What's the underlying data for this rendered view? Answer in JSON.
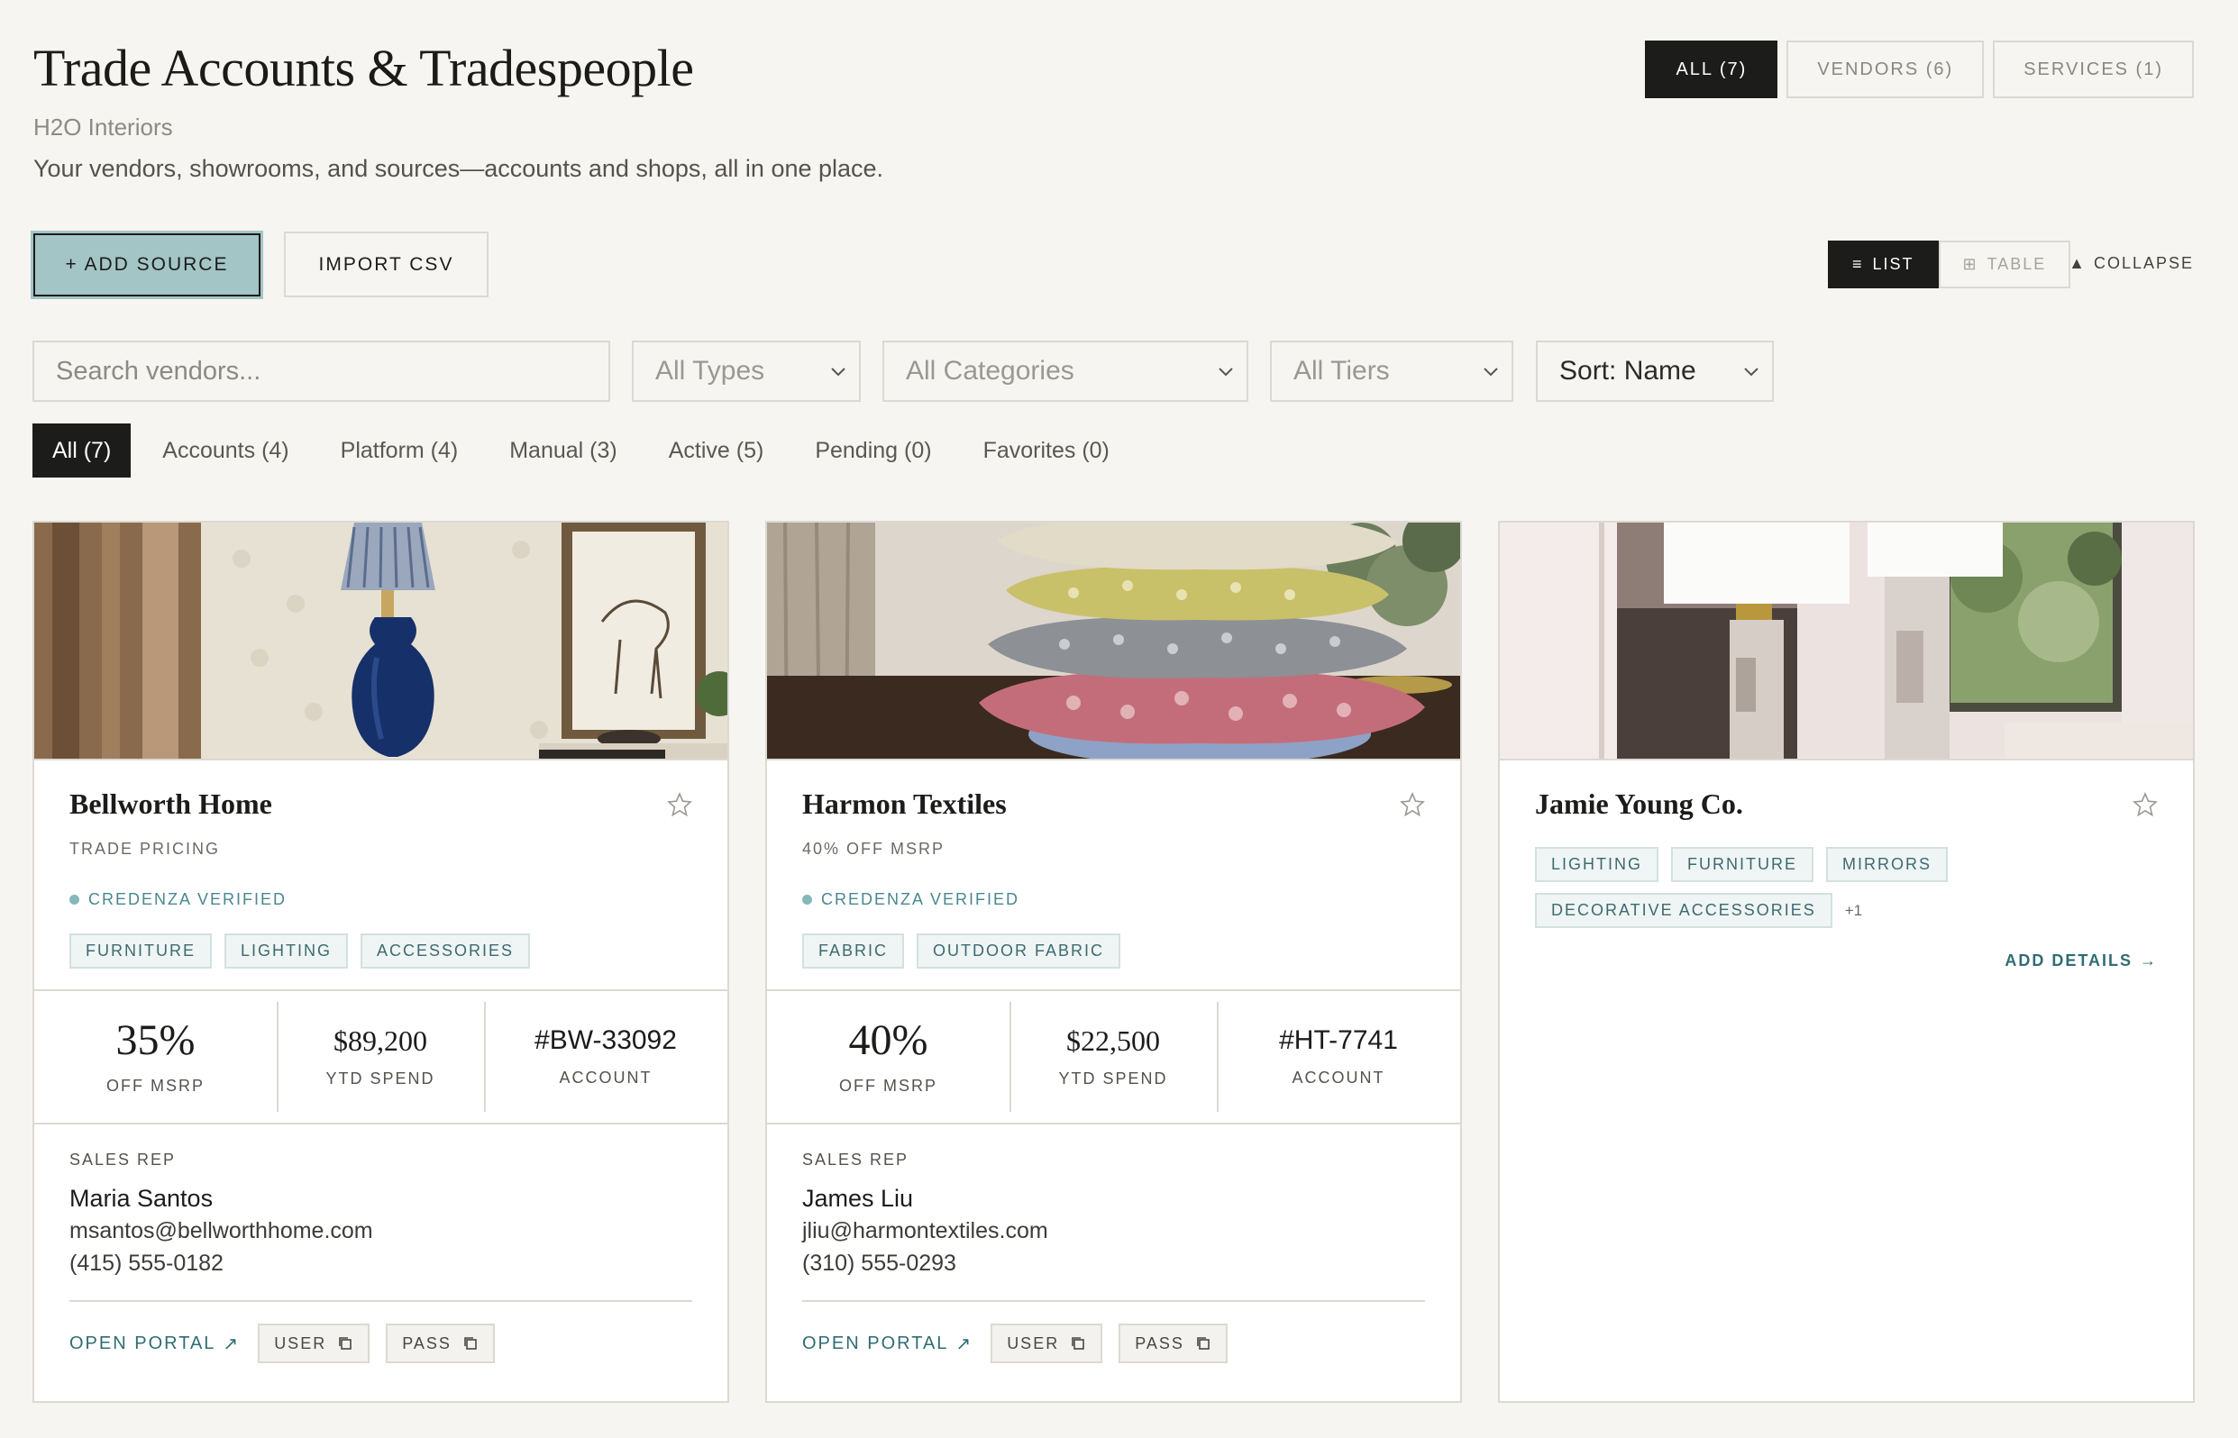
{
  "header": {
    "title": "Trade Accounts & Tradespeople",
    "studio": "H2O Interiors",
    "tagline": "Your vendors, showrooms, and sources—accounts and shops, all in one place."
  },
  "segment_tabs": [
    "ALL (7)",
    "VENDORS (6)",
    "SERVICES (1)"
  ],
  "actions": {
    "add_source": "+ ADD SOURCE",
    "import_csv": "IMPORT CSV"
  },
  "view_toggle": {
    "list": "LIST",
    "table": "TABLE",
    "collapse": "COLLAPSE"
  },
  "filters": {
    "search_placeholder": "Search vendors...",
    "types": "All Types",
    "categories": "All Categories",
    "tiers": "All Tiers",
    "sort": "Sort: Name"
  },
  "filter_tabs": [
    "All (7)",
    "Accounts (4)",
    "Platform (4)",
    "Manual (3)",
    "Active (5)",
    "Pending (0)",
    "Favorites (0)"
  ],
  "cards": [
    {
      "name": "Bellworth Home",
      "tier": "TRADE PRICING",
      "verified": "CREDENZA VERIFIED",
      "tags": [
        "FURNITURE",
        "LIGHTING",
        "ACCESSORIES"
      ],
      "discount": "35%",
      "discount_label": "OFF MSRP",
      "ytd": "$89,200",
      "ytd_label": "YTD SPEND",
      "account": "#BW-33092",
      "account_label": "ACCOUNT",
      "rep_label": "SALES REP",
      "rep_name": "Maria Santos",
      "rep_email": "msantos@bellworthhome.com",
      "rep_phone": "(415) 555-0182",
      "portal": "OPEN PORTAL",
      "user": "USER",
      "pass": "PASS"
    },
    {
      "name": "Harmon Textiles",
      "tier": "40% OFF MSRP",
      "verified": "CREDENZA VERIFIED",
      "tags": [
        "FABRIC",
        "OUTDOOR FABRIC"
      ],
      "discount": "40%",
      "discount_label": "OFF MSRP",
      "ytd": "$22,500",
      "ytd_label": "YTD SPEND",
      "account": "#HT-7741",
      "account_label": "ACCOUNT",
      "rep_label": "SALES REP",
      "rep_name": "James Liu",
      "rep_email": "jliu@harmontextiles.com",
      "rep_phone": "(310) 555-0293",
      "portal": "OPEN PORTAL",
      "user": "USER",
      "pass": "PASS"
    },
    {
      "name": "Jamie Young Co.",
      "tags": [
        "LIGHTING",
        "FURNITURE",
        "MIRRORS",
        "DECORATIVE ACCESSORIES"
      ],
      "more": "+1",
      "add_details": "ADD DETAILS"
    }
  ]
}
